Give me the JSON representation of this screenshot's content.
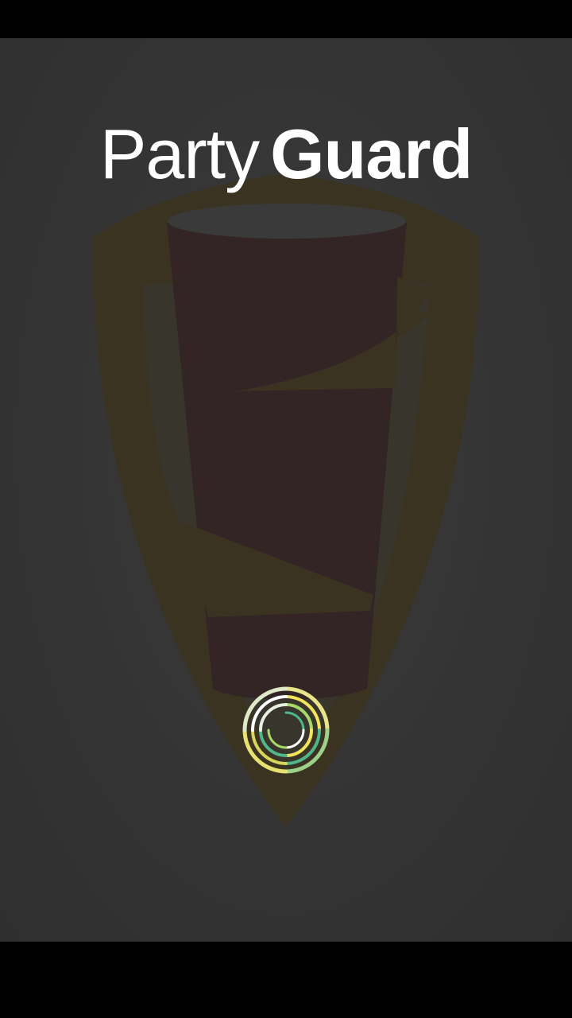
{
  "app": {
    "title_light": "Party",
    "title_bold": "Guard"
  },
  "logo": {
    "icon": "shield-cup-logo",
    "shield_color": "#3a3322",
    "cup_color": "#332425",
    "cup_rim_color": "#3a3a3a"
  },
  "loading": {
    "icon": "swirl-spinner-icon",
    "colors": [
      "#f2e45c",
      "#a6d96a",
      "#4fb58a",
      "#ffffff"
    ]
  }
}
